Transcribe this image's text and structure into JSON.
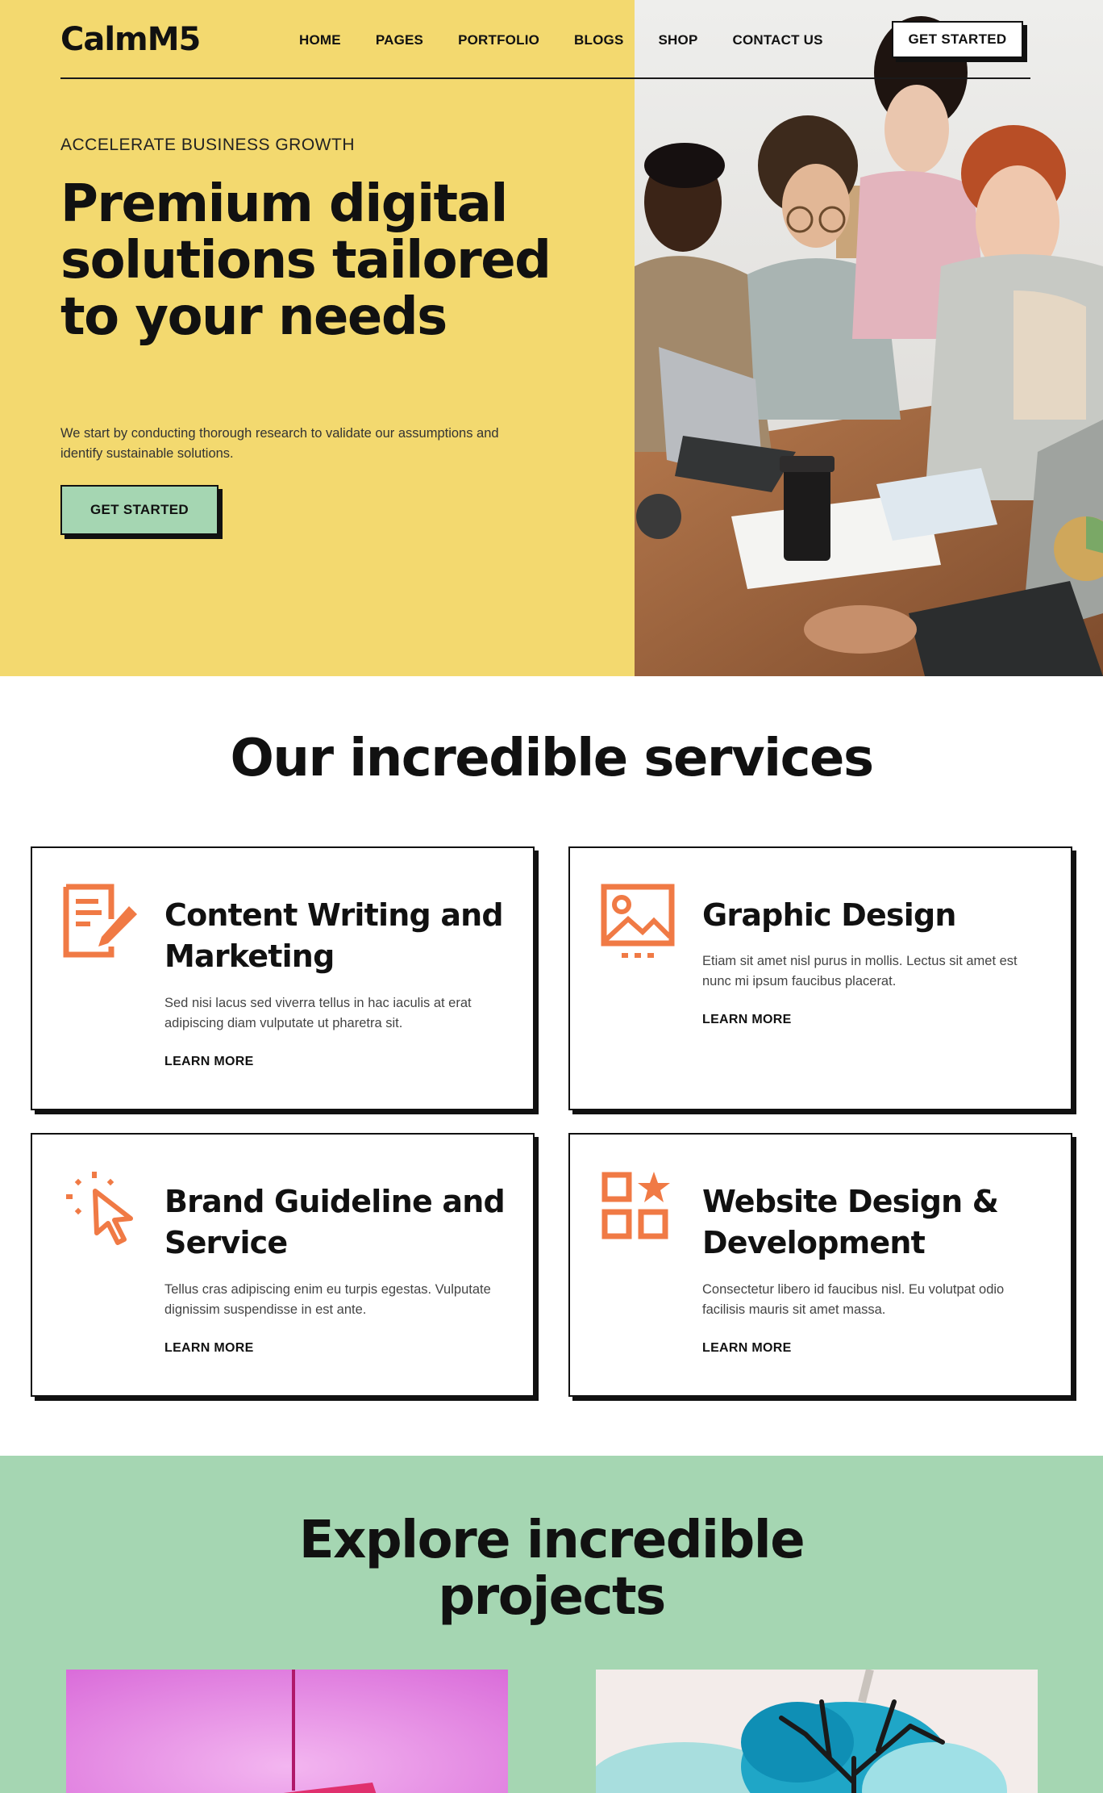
{
  "brand": {
    "logo": "CalmM5"
  },
  "nav": {
    "items": [
      "HOME",
      "PAGES",
      "PORTFOLIO",
      "BLOGS",
      "SHOP",
      "CONTACT US"
    ],
    "cta": "GET STARTED"
  },
  "hero": {
    "eyebrow": "ACCELERATE BUSINESS GROWTH",
    "title": "Premium digital solutions tailored to your needs",
    "description": "We start by conducting thorough research to validate our assumptions and identify sustainable solutions.",
    "cta": "GET STARTED",
    "image": "team-working-on-laptops-photo"
  },
  "services": {
    "title": "Our incredible services",
    "cards": [
      {
        "icon": "document-edit-icon",
        "title": "Content Writing and Marketing",
        "description": "Sed nisi lacus sed viverra tellus in hac iaculis at erat adipiscing diam vulputate ut pharetra sit.",
        "link": "LEARN MORE"
      },
      {
        "icon": "image-icon",
        "title": "Graphic Design",
        "description": "Etiam sit amet nisl purus in mollis. Lectus sit amet est nunc mi ipsum faucibus placerat.",
        "link": "LEARN MORE"
      },
      {
        "icon": "cursor-click-icon",
        "title": "Brand Guideline and Service",
        "description": "Tellus cras adipiscing enim eu turpis egestas. Vulputate dignissim suspendisse in est ante.",
        "link": "LEARN MORE"
      },
      {
        "icon": "apps-star-icon",
        "title": "Website Design & Development",
        "description": "Consectetur libero id faucibus nisl. Eu volutpat odio facilisis mauris sit amet massa.",
        "link": "LEARN MORE"
      }
    ]
  },
  "projects": {
    "title": "Explore incredible projects",
    "images": [
      "pink-hanging-frame-image",
      "blue-tree-watercolor-image"
    ]
  },
  "colors": {
    "hero_yellow": "#f3d96f",
    "mint": "#a5d6b2",
    "accent_orange": "#f07a45",
    "ink": "#111111"
  }
}
